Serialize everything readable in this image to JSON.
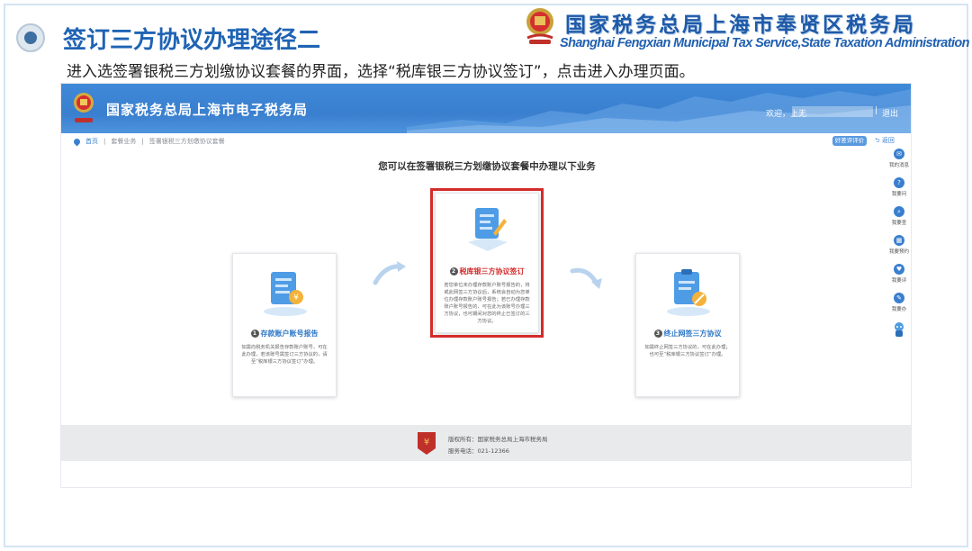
{
  "slide": {
    "title": "签订三方协议办理途径二",
    "org_name_cn": "国家税务总局上海市奉贤区税务局",
    "org_name_en": "Shanghai Fengxian Municipal Tax Service,State Taxation  Administration",
    "instruction": "进入选签署银税三方划缴协议套餐的界面，选择“税库银三方协议签订”，点击进入办理页面。"
  },
  "portal": {
    "site_title": "国家税务总局上海市电子税务局",
    "welcome": "欢迎，上无",
    "logout": "退出",
    "breadcrumb": [
      "首页",
      "套餐业务",
      "签署银税三方划缴协议套餐"
    ],
    "eval_button": "好差评评价",
    "back": "返回",
    "main_heading": "您可以在签署银税三方划缴协议套餐中办理以下业务",
    "right_rail": [
      {
        "label": "我的消息",
        "icon": "message-icon"
      },
      {
        "label": "我要问",
        "icon": "question-icon"
      },
      {
        "label": "我要查",
        "icon": "search-icon"
      },
      {
        "label": "我要预约",
        "icon": "calendar-icon"
      },
      {
        "label": "我要评",
        "icon": "heart-icon"
      },
      {
        "label": "我要办",
        "icon": "edit-icon"
      },
      {
        "label": "",
        "icon": "robot-icon"
      }
    ],
    "cards": [
      {
        "num": "1",
        "title": "存款账户账号报告",
        "desc": "如需向税务机关报告存款账户账号，可在此办理，若该账号需签订三方协议的，请至“税库银三方协议签订”办理。"
      },
      {
        "num": "2",
        "title": "税库银三方协议签订",
        "desc": "若您单位未办理存款账户账号报告的，将或此网签三方协议后，系统会自动为您单位办理存款账户账号报告；若已办理存款账户账号报告的，可在此为该账号办理三方协议，也可期间对您的终止已签订的三方协议。"
      },
      {
        "num": "3",
        "title": "终止网签三方协议",
        "desc": "如需终止网签三方协议的，可在此办理；也可至“税库银三方协议签订”办理。"
      }
    ],
    "footer": {
      "copyright": "版权所有：国家税务总局上海市税务局",
      "phone": "服务电话：021-12366"
    }
  },
  "colors": {
    "title_blue": "#1f63b4",
    "header_blue": "#3a7fcf",
    "highlight_red": "#d32b2b"
  }
}
